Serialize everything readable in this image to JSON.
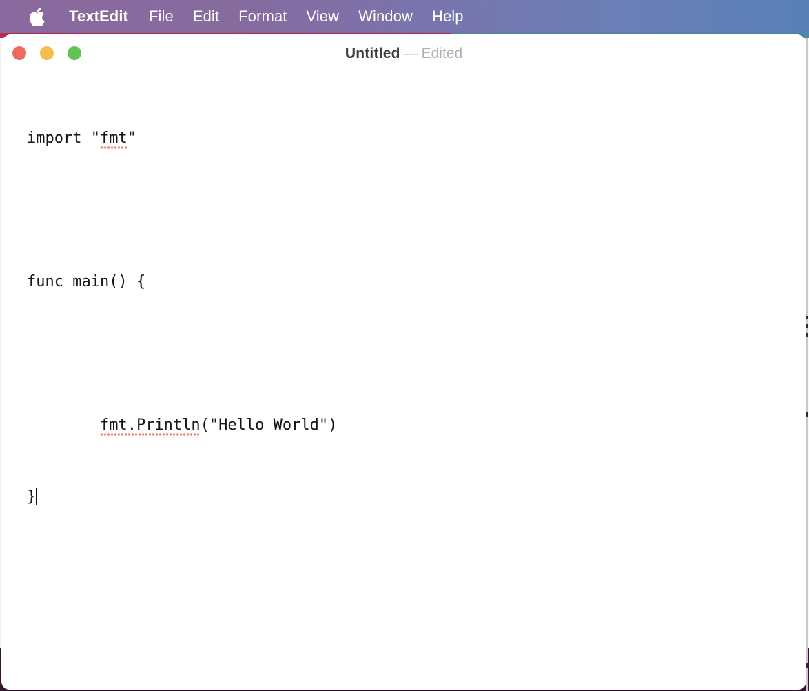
{
  "menubar": {
    "apple_icon": "apple-logo-icon",
    "items": [
      {
        "label": "TextEdit",
        "bold": true
      },
      {
        "label": "File",
        "bold": false
      },
      {
        "label": "Edit",
        "bold": false
      },
      {
        "label": "Format",
        "bold": false
      },
      {
        "label": "View",
        "bold": false
      },
      {
        "label": "Window",
        "bold": false
      },
      {
        "label": "Help",
        "bold": false
      }
    ],
    "gradient_left": "#8a6a9e",
    "gradient_right": "#5a80b8"
  },
  "window": {
    "traffic_lights": {
      "close_color": "#ec6a5e",
      "minimize_color": "#f5bd4f",
      "zoom_color": "#61c454",
      "close_label": "Close",
      "minimize_label": "Minimize",
      "zoom_label": "Zoom"
    },
    "title": {
      "document_name": "Untitled",
      "separator": "—",
      "status": "Edited"
    }
  },
  "document": {
    "lines": [
      {
        "id": "line1",
        "prefix": "import \"",
        "misspelled": "fmt",
        "suffix": "\""
      },
      {
        "id": "line2",
        "text": "func main() {"
      },
      {
        "id": "line3",
        "indent": "        ",
        "misspelled": "fmt.Println",
        "suffix": "(\"Hello World\")"
      },
      {
        "id": "line4",
        "text": "}"
      }
    ],
    "full_text": "import \"fmt\"\n\nfunc main() {\n\n        fmt.Println(\"Hello World\")\n}",
    "spellcheck_color": "#ef7f6f",
    "caret_visible": true,
    "text_color": "#161616"
  },
  "desktop": {
    "strip_left_color": "#bc2b52",
    "strip_right_color": "#4b8ba3",
    "bottom_color": "#3a1430"
  }
}
